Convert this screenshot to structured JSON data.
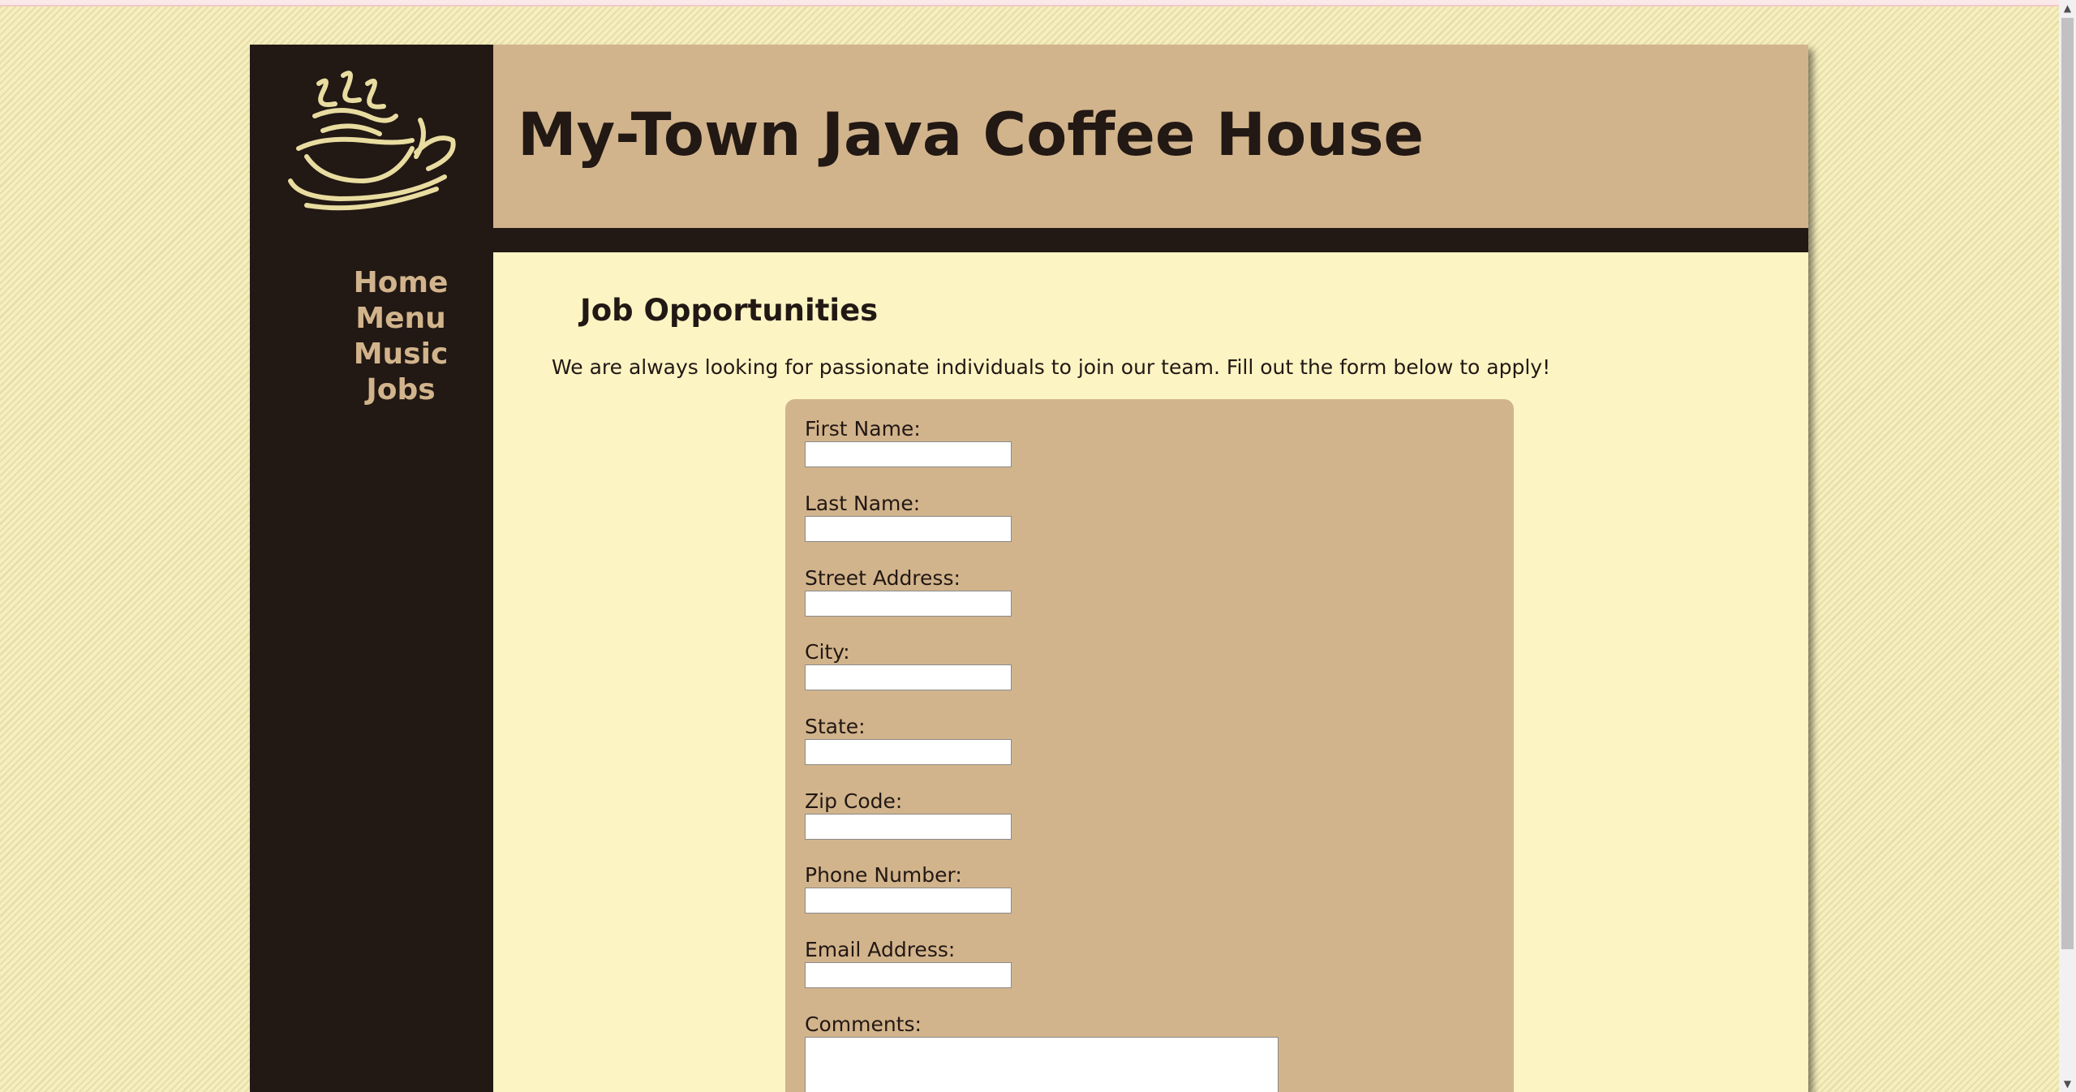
{
  "site": {
    "title": "My-Town Java Coffee House",
    "logo_icon": "coffee-cup-icon"
  },
  "nav": {
    "items": [
      {
        "label": "Home"
      },
      {
        "label": "Menu"
      },
      {
        "label": "Music"
      },
      {
        "label": "Jobs"
      }
    ]
  },
  "content": {
    "heading": "Job Opportunities",
    "intro": "We are always looking for passionate individuals to join our team. Fill out the form below to apply!"
  },
  "form": {
    "fields": [
      {
        "label": "First Name:",
        "value": ""
      },
      {
        "label": "Last Name:",
        "value": ""
      },
      {
        "label": "Street Address:",
        "value": ""
      },
      {
        "label": "City:",
        "value": ""
      },
      {
        "label": "State:",
        "value": ""
      },
      {
        "label": "Zip Code:",
        "value": ""
      },
      {
        "label": "Phone Number:",
        "value": ""
      },
      {
        "label": "Email Address:",
        "value": ""
      }
    ],
    "comments": {
      "label": "Comments:",
      "value": ""
    }
  },
  "colors": {
    "dark_brown": "#221814",
    "tan": "#d2b48c",
    "cream": "#fcf4c3",
    "logo_gold": "#e8dca0"
  }
}
